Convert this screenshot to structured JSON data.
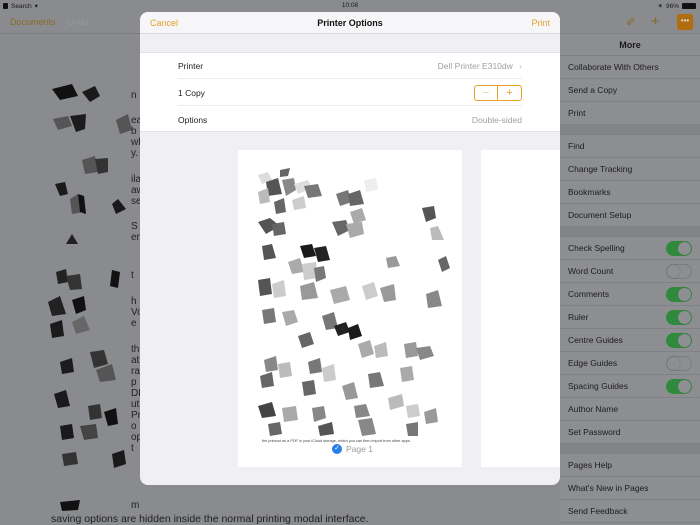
{
  "status_bar": {
    "back_label": "Search",
    "time": "10:08",
    "battery": "96%"
  },
  "app_toolbar": {
    "documents_label": "Documents",
    "undo_label": "Undo",
    "icons": [
      "paintbrush-icon",
      "plus-icon",
      "more-icon"
    ],
    "accent_color": "#e5a02c"
  },
  "document": {
    "visible_letters": [
      "n",
      "ea",
      "b",
      "wh",
      "y.",
      "ila",
      "aw",
      "se",
      "S",
      "en",
      "t",
      "h",
      "Vo",
      "e",
      "th",
      "at",
      "ra",
      "p",
      "DF",
      "ut",
      "Pr",
      "o",
      "op",
      "t",
      "m"
    ],
    "bottom_line": "saving options are hidden inside the normal printing modal interface."
  },
  "more_panel": {
    "title": "More",
    "groups": [
      {
        "items": [
          {
            "label": "Collaborate With Others"
          },
          {
            "label": "Send a Copy"
          },
          {
            "label": "Print"
          }
        ]
      },
      {
        "items": [
          {
            "label": "Find"
          },
          {
            "label": "Change Tracking"
          },
          {
            "label": "Bookmarks"
          },
          {
            "label": "Document Setup"
          }
        ]
      },
      {
        "items": [
          {
            "label": "Check Spelling",
            "toggle": true
          },
          {
            "label": "Word Count",
            "toggle": false
          },
          {
            "label": "Comments",
            "toggle": true
          },
          {
            "label": "Ruler",
            "toggle": true
          },
          {
            "label": "Centre Guides",
            "toggle": true
          },
          {
            "label": "Edge Guides",
            "toggle": false
          },
          {
            "label": "Spacing Guides",
            "toggle": true
          },
          {
            "label": "Author Name"
          },
          {
            "label": "Set Password"
          }
        ]
      },
      {
        "items": [
          {
            "label": "Pages Help"
          },
          {
            "label": "What's New in Pages"
          },
          {
            "label": "Send Feedback"
          }
        ]
      }
    ]
  },
  "printer_modal": {
    "title": "Printer Options",
    "cancel_label": "Cancel",
    "print_label": "Print",
    "printer_label": "Printer",
    "printer_value": "Dell Printer E310dw",
    "copies_label": "1 Copy",
    "copies": 1,
    "stepper_minus": "−",
    "stepper_plus": "+",
    "options_label": "Options",
    "options_value": "Double-sided",
    "preview_caption": "the printout as a PDF in your iCloud storage, which you can then import from other apps.",
    "page_label": "Page 1",
    "page_selected": true
  }
}
